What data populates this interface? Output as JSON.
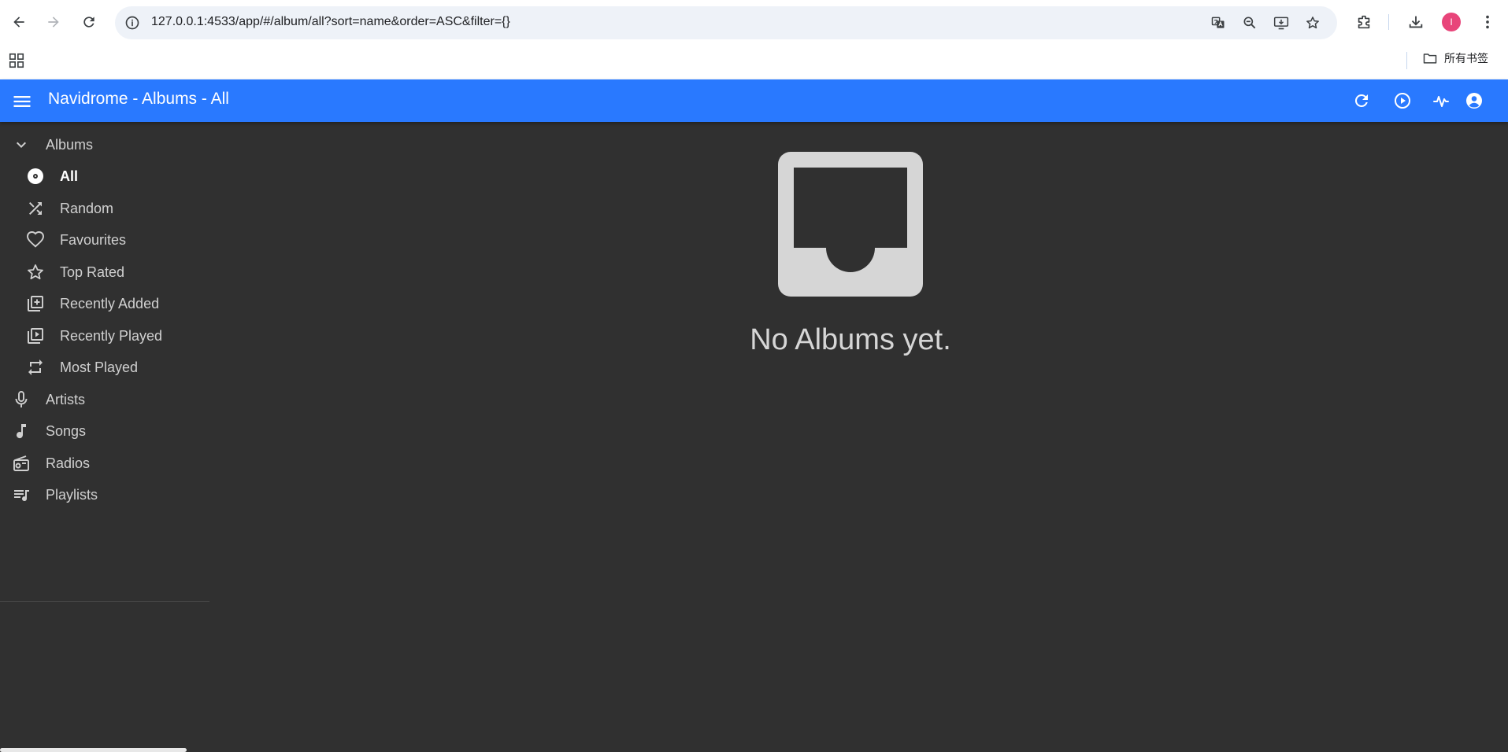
{
  "browser": {
    "url": "127.0.0.1:4533/app/#/album/all?sort=name&order=ASC&filter={}",
    "profile_initial": "I",
    "bookmark_folder": "所有书签"
  },
  "app": {
    "title": "Navidrome - Albums - All",
    "accent_color": "#2979ff",
    "background_color": "#303030"
  },
  "sidebar": {
    "albums_group": "Albums",
    "album_items": [
      {
        "label": "All",
        "icon": "album-disc-icon",
        "active": true
      },
      {
        "label": "Random",
        "icon": "shuffle-icon",
        "active": false
      },
      {
        "label": "Favourites",
        "icon": "heart-outline-icon",
        "active": false
      },
      {
        "label": "Top Rated",
        "icon": "star-outline-icon",
        "active": false
      },
      {
        "label": "Recently Added",
        "icon": "library-add-icon",
        "active": false
      },
      {
        "label": "Recently Played",
        "icon": "video-library-icon",
        "active": false
      },
      {
        "label": "Most Played",
        "icon": "repeat-icon",
        "active": false
      }
    ],
    "items": [
      {
        "label": "Artists",
        "icon": "microphone-icon"
      },
      {
        "label": "Songs",
        "icon": "music-note-icon"
      },
      {
        "label": "Radios",
        "icon": "radio-icon"
      },
      {
        "label": "Playlists",
        "icon": "queue-music-icon"
      }
    ]
  },
  "main": {
    "empty_message": "No Albums yet.",
    "empty_icon": "inbox-icon"
  }
}
